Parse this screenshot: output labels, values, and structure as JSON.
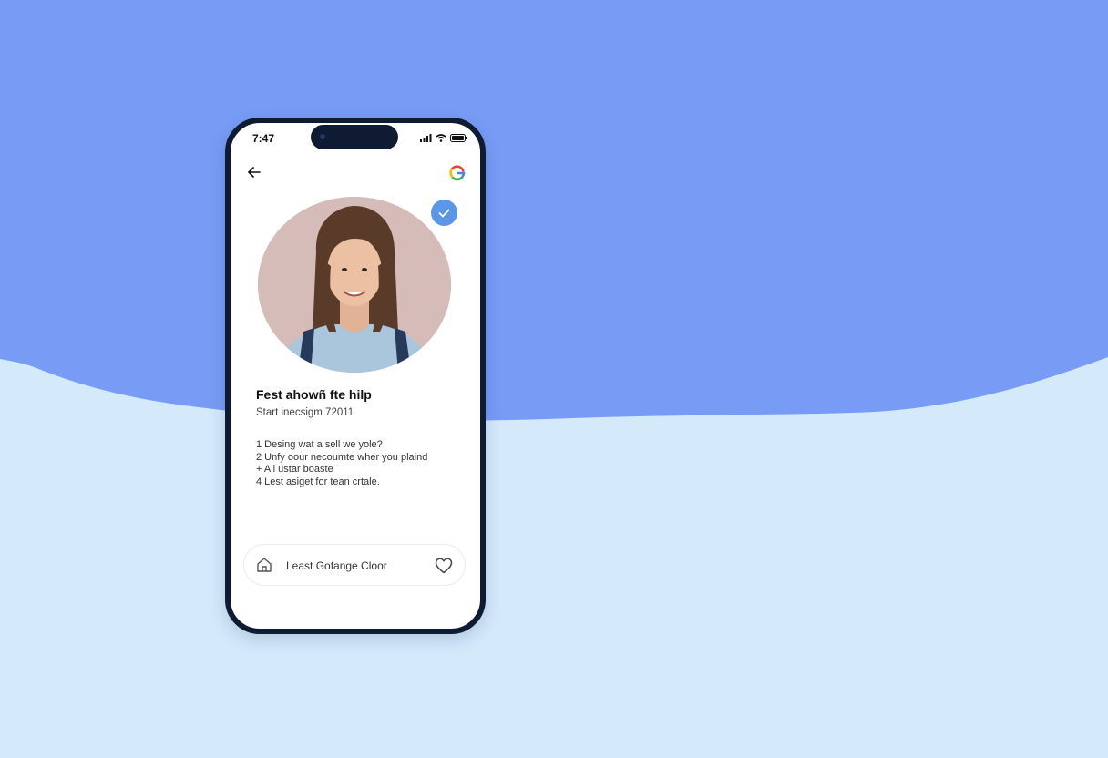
{
  "colors": {
    "background_top": "#789cf5",
    "background_bottom": "#d4eafb",
    "phone_frame": "#0f1a33",
    "verified_badge": "#5b97e6"
  },
  "status_bar": {
    "time": "7:47",
    "icons": [
      "signal-icon",
      "wifi-icon",
      "battery-icon"
    ]
  },
  "header": {
    "back_icon": "arrow-left-icon",
    "logo_icon": "google-g-icon"
  },
  "profile": {
    "verified_icon": "checkmark-icon",
    "name": "Fest ahowñ fte hilp",
    "subtitle": "Start inecsigm 72011",
    "list": [
      "1 Desing wat a sell we yole?",
      "2 Unfy oour necoumte wher you plaind",
      "+ All ustar boaste",
      "4 Lest asiget for tean crtale."
    ]
  },
  "bottom_card": {
    "home_icon": "home-icon",
    "label": "Least Gofange Cloor",
    "favorite_icon": "heart-icon"
  }
}
